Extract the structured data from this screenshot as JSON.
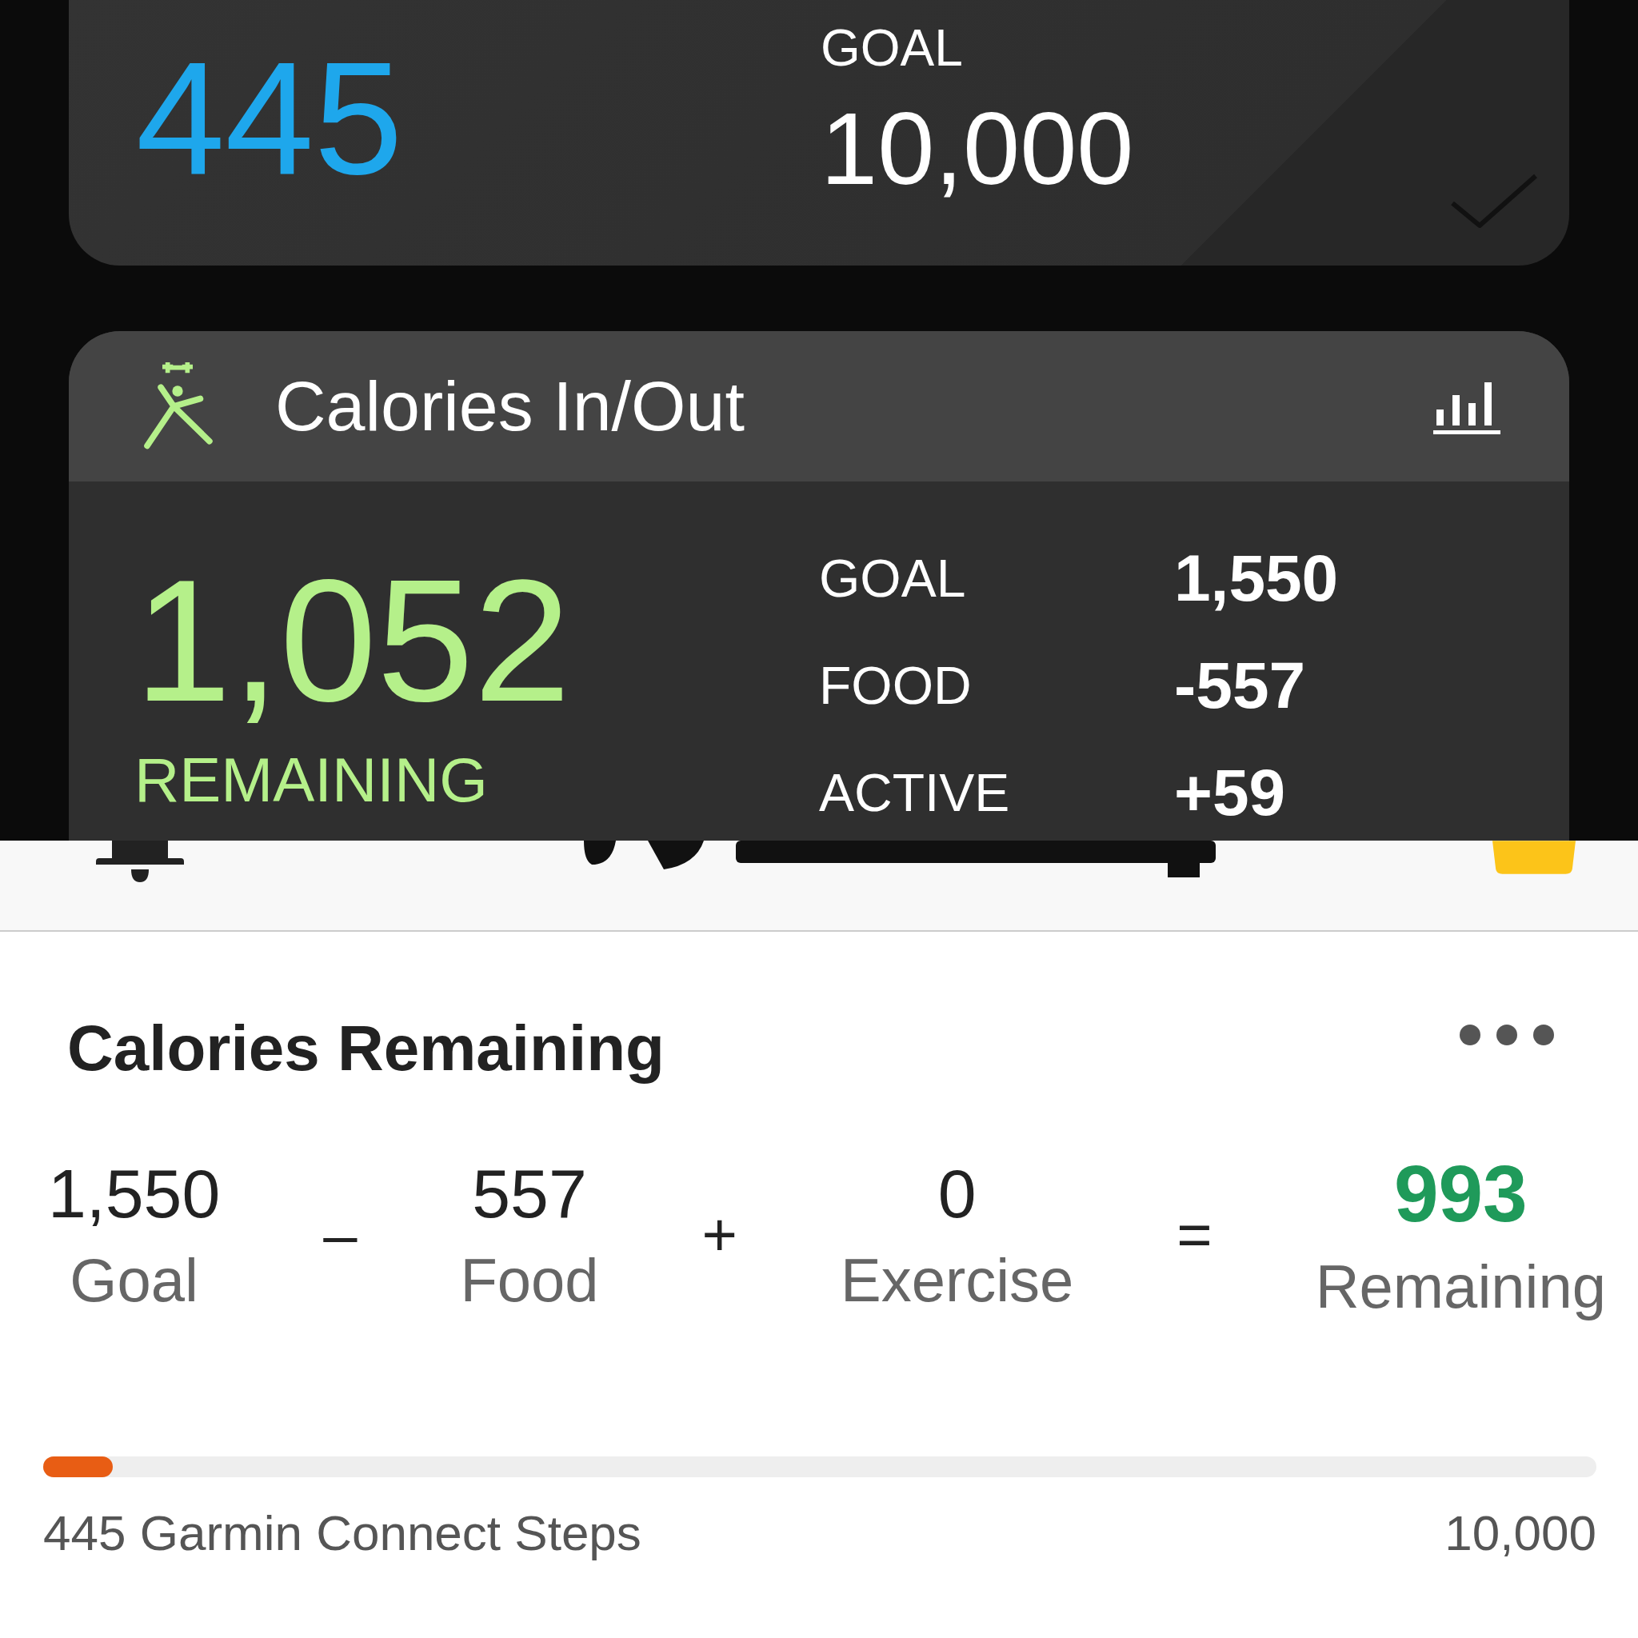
{
  "steps_card": {
    "value": "445",
    "goal_label": "GOAL",
    "goal_value": "10,000"
  },
  "calories_card": {
    "title": "Calories In/Out",
    "remaining_value": "1,052",
    "remaining_label": "REMAINING",
    "rows": [
      {
        "label": "GOAL",
        "value": "1,550"
      },
      {
        "label": "FOOD",
        "value": "-557"
      },
      {
        "label": "ACTIVE",
        "value": "+59"
      }
    ]
  },
  "calories_remaining": {
    "title": "Calories Remaining",
    "terms": [
      {
        "value": "1,550",
        "label": "Goal",
        "highlight": false
      },
      {
        "value": "557",
        "label": "Food",
        "highlight": false
      },
      {
        "value": "0",
        "label": "Exercise",
        "highlight": false
      },
      {
        "value": "993",
        "label": "Remaining",
        "highlight": true
      }
    ],
    "operators": [
      "–",
      "+",
      "="
    ]
  },
  "steps_progress": {
    "level": 0.045,
    "label": "445 Garmin Connect Steps",
    "goal": "10,000"
  }
}
